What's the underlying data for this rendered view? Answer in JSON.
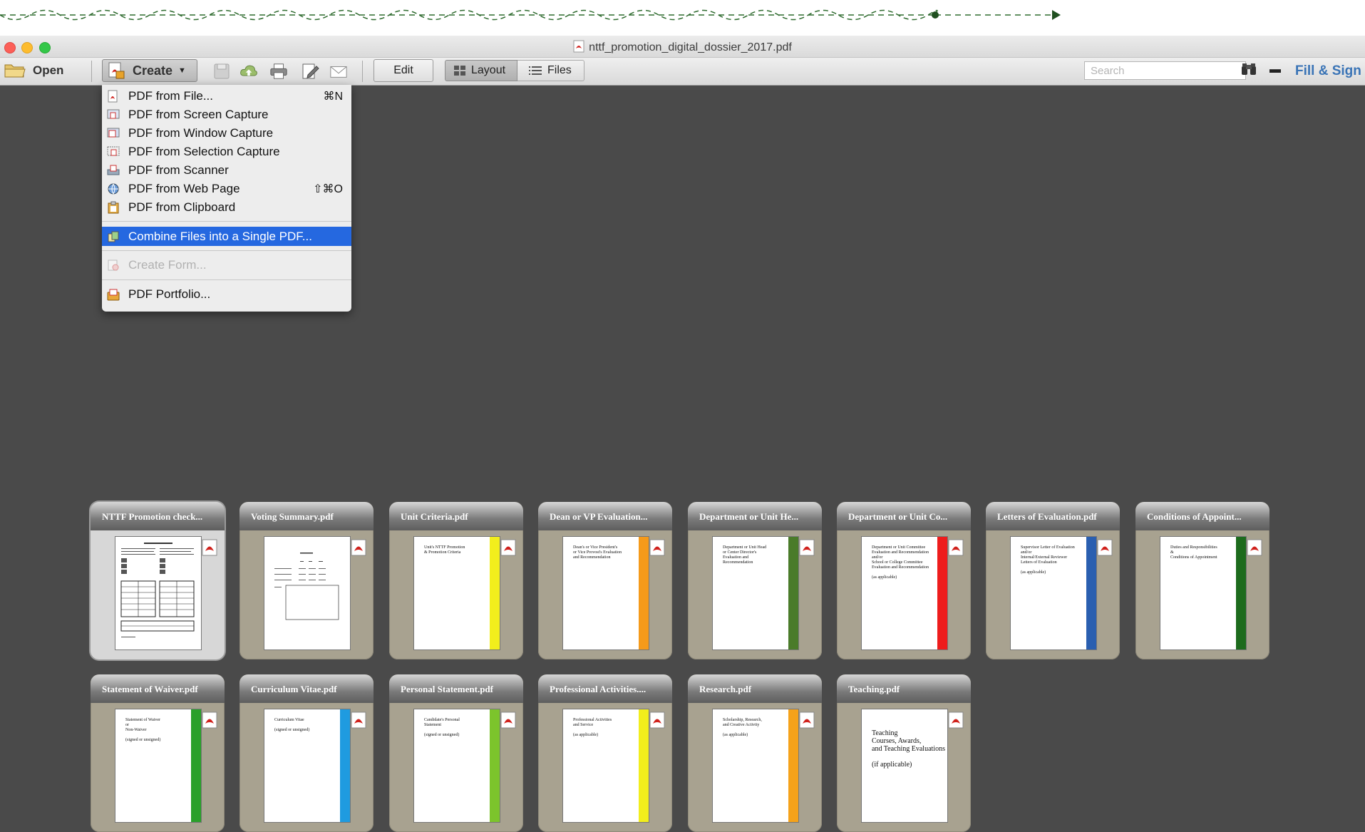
{
  "window": {
    "title": "nttf_promotion_digital_dossier_2017.pdf"
  },
  "toolbar": {
    "open_label": "Open",
    "create_label": "Create",
    "edit_label": "Edit",
    "layout_label": "Layout",
    "files_label": "Files",
    "search_placeholder": "Search",
    "fill_sign_label": "Fill & Sign"
  },
  "create_menu": {
    "items": [
      {
        "label": "PDF from File...",
        "shortcut": "⌘N"
      },
      {
        "label": "PDF from Screen Capture",
        "shortcut": ""
      },
      {
        "label": "PDF from Window Capture",
        "shortcut": ""
      },
      {
        "label": "PDF from Selection Capture",
        "shortcut": ""
      },
      {
        "label": "PDF from Scanner",
        "shortcut": ""
      },
      {
        "label": "PDF from Web Page",
        "shortcut": "⇧⌘O"
      },
      {
        "label": "PDF from Clipboard",
        "shortcut": ""
      },
      {
        "label": "Combine Files into a Single PDF...",
        "shortcut": ""
      },
      {
        "label": "Create Form...",
        "shortcut": ""
      },
      {
        "label": "PDF Portfolio...",
        "shortcut": ""
      }
    ],
    "highlight_color": "#2568e0"
  },
  "files": [
    {
      "name": "NTTF Promotion check...",
      "bar_color": "",
      "page_text": ""
    },
    {
      "name": "Voting Summary.pdf",
      "bar_color": "",
      "page_text": ""
    },
    {
      "name": "Unit Criteria.pdf",
      "bar_color": "#f2ee1c",
      "page_text": "Unit's NTTF Promotion\n& Promotion Criteria"
    },
    {
      "name": "Dean or VP Evaluation...",
      "bar_color": "#f59a1a",
      "page_text": "Dean's or Vice President's\nor Vice Provost's Evaluation\nand Recommendation"
    },
    {
      "name": "Department or Unit He...",
      "bar_color": "#4a7b2a",
      "page_text": "Department or Unit Head\nor Center Director's\nEvaluation and\nRecommendation"
    },
    {
      "name": "Department or Unit Co...",
      "bar_color": "#ee1c1c",
      "page_text": "Department or Unit Committee\nEvaluation and Recommendation\nand/or\nSchool or College Committee\nEvaluation and Recommendation\n\n(as applicable)"
    },
    {
      "name": "Letters of Evaluation.pdf",
      "bar_color": "#2a5fb0",
      "page_text": "Supervisor Letter of Evaluation\nand/or\nInternal/External Reviewer\nLetters of Evaluation\n\n(as applicable)"
    },
    {
      "name": "Conditions of Appoint...",
      "bar_color": "#1d6b1d",
      "page_text": "Duties and Responsibilities\n&\nConditions of Appointment"
    },
    {
      "name": "Statement of Waiver.pdf",
      "bar_color": "#2aa02a",
      "page_text": "Statement of Waiver\nor\nNon-Waiver\n\n(signed or unsigned)"
    },
    {
      "name": "Curriculum Vitae.pdf",
      "bar_color": "#1f9be0",
      "page_text": "Curriculum Vitae\n\n(signed or unsigned)"
    },
    {
      "name": "Personal Statement.pdf",
      "bar_color": "#7cc42c",
      "page_text": "Candidate's Personal\nStatement\n\n(signed or unsigned)"
    },
    {
      "name": "Professional Activities....",
      "bar_color": "#f2ee1c",
      "page_text": "Professional Activities\nand Service\n\n(as applicable)"
    },
    {
      "name": "Research.pdf",
      "bar_color": "#f5a21a",
      "page_text": "Scholarship, Research,\nand Creative Activity\n\n(as applicable)"
    },
    {
      "name": "Teaching.pdf",
      "bar_color": "",
      "page_text": "Teaching\nCourses, Awards,\nand Teaching Evaluations\n\n(if applicable)"
    }
  ]
}
